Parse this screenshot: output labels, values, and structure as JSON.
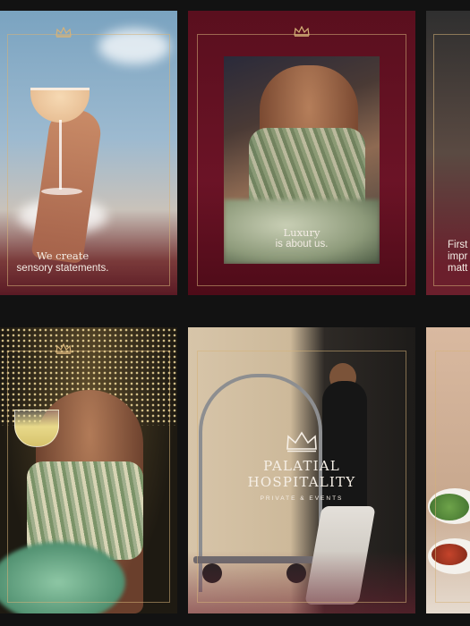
{
  "cards": [
    {
      "caption_line1": "We create",
      "caption_line2": "sensory statements."
    },
    {
      "caption_line1": "Luxury",
      "caption_line2": "is about us."
    },
    {
      "caption_line1": "First",
      "caption_line2": "impr",
      "caption_line3": "matt"
    },
    {},
    {
      "logo_line1": "PALATIAL",
      "logo_line2": "HOSPITALITY",
      "logo_sub": "PRIVATE  &  EVENTS"
    },
    {}
  ],
  "icons": {
    "crown": "crown-icon"
  },
  "colors": {
    "burgundy": "#6b1326",
    "gold": "#d6b278",
    "background": "#121212"
  }
}
